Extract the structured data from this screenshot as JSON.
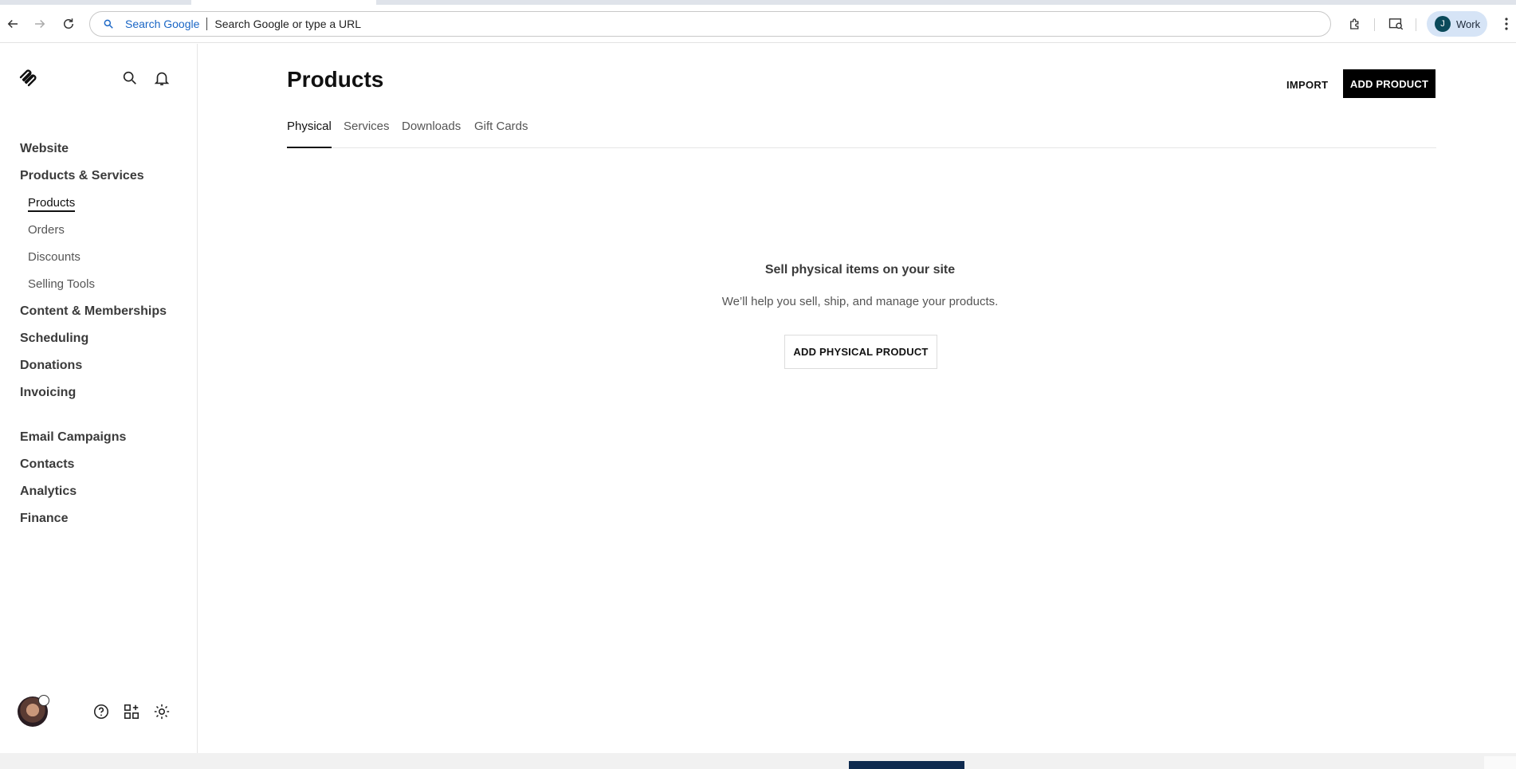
{
  "browser": {
    "search_engine_label": "Search Google",
    "omnibox_placeholder": "Search Google or type a URL",
    "profile_initial": "J",
    "profile_label": "Work"
  },
  "sidebar": {
    "sections": [
      {
        "label": "Website"
      },
      {
        "label": "Products & Services"
      },
      {
        "label": "Content & Memberships"
      },
      {
        "label": "Scheduling"
      },
      {
        "label": "Donations"
      },
      {
        "label": "Invoicing"
      },
      {
        "label": "Email Campaigns"
      },
      {
        "label": "Contacts"
      },
      {
        "label": "Analytics"
      },
      {
        "label": "Finance"
      }
    ],
    "sub_items": [
      {
        "label": "Products",
        "active": true
      },
      {
        "label": "Orders"
      },
      {
        "label": "Discounts"
      },
      {
        "label": "Selling Tools"
      }
    ]
  },
  "main": {
    "title": "Products",
    "import_label": "IMPORT",
    "add_product_label": "ADD PRODUCT",
    "tabs": [
      {
        "label": "Physical",
        "active": true
      },
      {
        "label": "Services"
      },
      {
        "label": "Downloads"
      },
      {
        "label": "Gift Cards"
      }
    ],
    "empty_state": {
      "title": "Sell physical items on your site",
      "description": "We’ll help you sell, ship, and manage your products.",
      "button_label": "ADD PHYSICAL PRODUCT"
    }
  },
  "colors": {
    "primary_button": "#000000",
    "profile_chip": "#d6e4f6",
    "search_engine_text": "#1a66c5"
  }
}
